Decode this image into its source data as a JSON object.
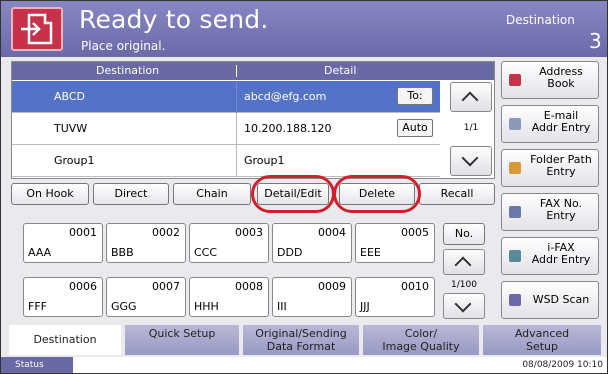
{
  "header": {
    "title": "Ready to send.",
    "subtitle": "Place original.",
    "destination_label": "Destination",
    "destination_count": "3"
  },
  "table": {
    "col_destination": "Destination",
    "col_detail": "Detail",
    "rows": [
      {
        "name": "ABCD",
        "detail": "abcd@efg.com",
        "button": "To:",
        "selected": true
      },
      {
        "name": "TUVW",
        "detail": "10.200.188.120",
        "button": "Auto",
        "selected": false
      },
      {
        "name": "Group1",
        "detail": "Group1",
        "button": "",
        "selected": false
      }
    ],
    "page": "1/1"
  },
  "right_buttons": [
    {
      "label": "Address\nBook",
      "icon": "address-book-icon",
      "color": "#c8314a"
    },
    {
      "label": "E-mail\nAddr Entry",
      "icon": "email-icon",
      "color": "#8a9ab8"
    },
    {
      "label": "Folder Path\nEntry",
      "icon": "folder-icon",
      "color": "#d89a3a"
    },
    {
      "label": "FAX No.\nEntry",
      "icon": "fax-icon",
      "color": "#6a7aa8"
    },
    {
      "label": "i-FAX\nAddr Entry",
      "icon": "ifax-icon",
      "color": "#5a8a9a"
    },
    {
      "label": "WSD Scan",
      "icon": "wsd-scan-icon",
      "color": "#6c69a9"
    }
  ],
  "function_buttons": {
    "on_hook": "On Hook",
    "direct": "Direct",
    "chain": "Chain",
    "detail_edit": "Detail/Edit",
    "delete": "Delete",
    "recall": "Recall"
  },
  "speed_dial": {
    "no_button": "No.",
    "page": "1/100",
    "entries": [
      {
        "num": "0001",
        "name": "AAA"
      },
      {
        "num": "0002",
        "name": "BBB"
      },
      {
        "num": "0003",
        "name": "CCC"
      },
      {
        "num": "0004",
        "name": "DDD"
      },
      {
        "num": "0005",
        "name": "EEE"
      },
      {
        "num": "0006",
        "name": "FFF"
      },
      {
        "num": "0007",
        "name": "GGG"
      },
      {
        "num": "0008",
        "name": "HHH"
      },
      {
        "num": "0009",
        "name": "III"
      },
      {
        "num": "0010",
        "name": "JJJ"
      }
    ]
  },
  "tabs": [
    {
      "label": "Destination",
      "active": true
    },
    {
      "label": "Quick Setup",
      "active": false
    },
    {
      "label": "Original/Sending\nData Format",
      "active": false
    },
    {
      "label": "Color/\nImage Quality",
      "active": false
    },
    {
      "label": "Advanced\nSetup",
      "active": false
    }
  ],
  "status": {
    "button": "Status",
    "datetime": "08/08/2009  10:10"
  }
}
